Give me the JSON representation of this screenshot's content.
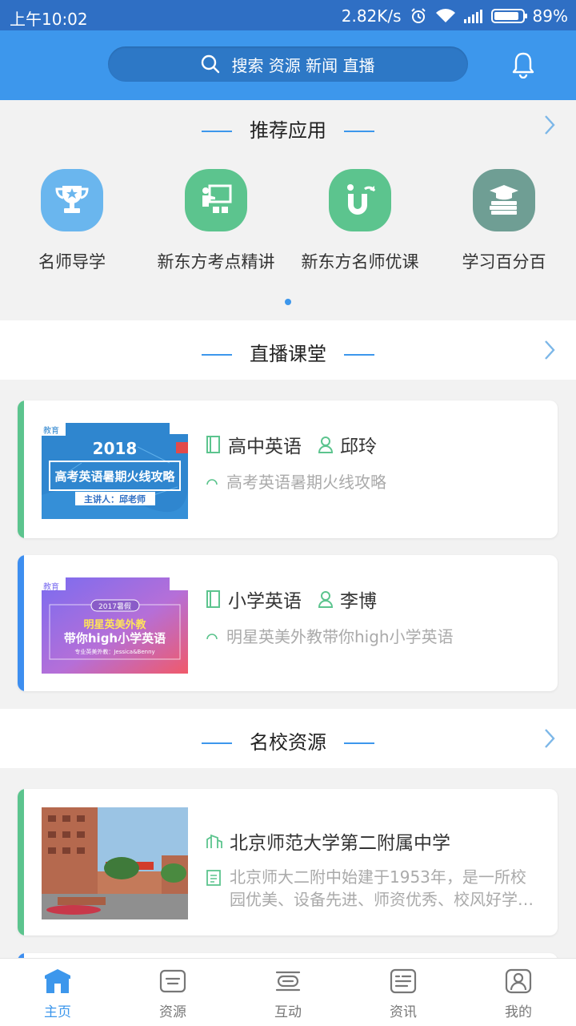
{
  "status_bar": {
    "time": "上午10:02",
    "speed": "2.82K/s",
    "battery": "89%",
    "battery_level": 0.89
  },
  "search": {
    "placeholder": "搜索 资源 新闻 直播"
  },
  "recommended": {
    "title": "推荐应用",
    "apps": [
      {
        "label": "名师导学",
        "icon": "trophy-icon",
        "color": "#6ab6ee"
      },
      {
        "label": "新东方考点精讲",
        "icon": "teacher-board-icon",
        "color": "#5cc48e"
      },
      {
        "label": "新东方名师优课",
        "icon": "u-magnet-icon",
        "color": "#5cc48e"
      },
      {
        "label": "学习百分百",
        "icon": "graduation-books-icon",
        "color": "#6f9e94"
      }
    ]
  },
  "live": {
    "title": "直播课堂",
    "courses": [
      {
        "subject": "高中英语",
        "teacher": "邱玲",
        "desc": "高考英语暑期火线攻略",
        "thumb": {
          "brand": "教育",
          "year": "2018",
          "headline": "高考英语暑期火线攻略",
          "speaker": "主讲人：邱老师"
        },
        "stripe_color": "#5cc48e"
      },
      {
        "subject": "小学英语",
        "teacher": "李博",
        "desc": "明星英美外教带你high小学英语",
        "thumb": {
          "brand": "教育",
          "badge": "2017暑假",
          "line1": "明星英美外教",
          "line2": "带你high小学英语",
          "small": "专业英美外教：Jessica&Benny"
        },
        "stripe_color": "#3d8ef0"
      }
    ]
  },
  "schools": {
    "title": "名校资源",
    "items": [
      {
        "name": "北京师范大学第二附属中学",
        "desc": "北京师大二附中始建于1953年，是一所校园优美、设备先进、师资优秀、校风好学…",
        "stripe_color": "#5cc48e"
      }
    ]
  },
  "tabs": [
    {
      "label": "主页",
      "icon": "home-icon",
      "active": true
    },
    {
      "label": "资源",
      "icon": "resource-icon",
      "active": false
    },
    {
      "label": "互动",
      "icon": "interact-icon",
      "active": false
    },
    {
      "label": "资讯",
      "icon": "news-icon",
      "active": false
    },
    {
      "label": "我的",
      "icon": "profile-icon",
      "active": false
    }
  ],
  "colors": {
    "primary": "#3d97ec",
    "green": "#5cc48e",
    "gray_text": "#aaaaaa"
  }
}
